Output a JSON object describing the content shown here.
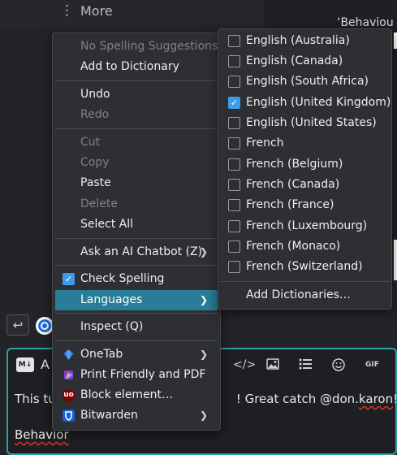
{
  "background": {
    "more_label": "More",
    "more_dots": "⋮",
    "quote_text": "‘Behaviou",
    "reply_glyph": "↩"
  },
  "editor": {
    "md_badge": "M↓",
    "mode_letter": "A",
    "toolbar_icons": [
      "code-icon",
      "image-icon",
      "list-icon",
      "emoji-icon",
      "gif-icon"
    ],
    "code_glyph": "</>",
    "gif_label": "GIF",
    "line1_start": "This tu",
    "line1_end": "! Great catch @",
    "mention_part1": "don.",
    "mention_part2": "karon",
    "line1_tail": "!!",
    "line2": "Behavior"
  },
  "context_menu": {
    "no_suggestions": "No Spelling Suggestions",
    "add_to_dictionary": "Add to Dictionary",
    "undo": "Undo",
    "redo": "Redo",
    "cut": "Cut",
    "copy": "Copy",
    "paste": "Paste",
    "delete": "Delete",
    "select_all": "Select All",
    "ask_ai": "Ask an AI Chatbot (Z)",
    "check_spelling": "Check Spelling",
    "languages": "Languages",
    "inspect": "Inspect (Q)",
    "onetab": "OneTab",
    "print_friendly": "Print Friendly and PDF",
    "block_element": "Block element…",
    "bitwarden": "Bitwarden"
  },
  "languages_menu": {
    "items": [
      {
        "label": "English (Australia)",
        "checked": false
      },
      {
        "label": "English (Canada)",
        "checked": false
      },
      {
        "label": "English (South Africa)",
        "checked": false
      },
      {
        "label": "English (United Kingdom)",
        "checked": true
      },
      {
        "label": "English (United States)",
        "checked": false
      },
      {
        "label": "French",
        "checked": false
      },
      {
        "label": "French (Belgium)",
        "checked": false
      },
      {
        "label": "French (Canada)",
        "checked": false
      },
      {
        "label": "French (France)",
        "checked": false
      },
      {
        "label": "French (Luxembourg)",
        "checked": false
      },
      {
        "label": "French (Monaco)",
        "checked": false
      },
      {
        "label": "French (Switzerland)",
        "checked": false
      }
    ],
    "add_dictionaries": "Add Dictionaries…"
  },
  "colors": {
    "highlight": "#2a7d96",
    "checkbox_on": "#3d9be9",
    "editor_border": "#2aa3a6"
  }
}
